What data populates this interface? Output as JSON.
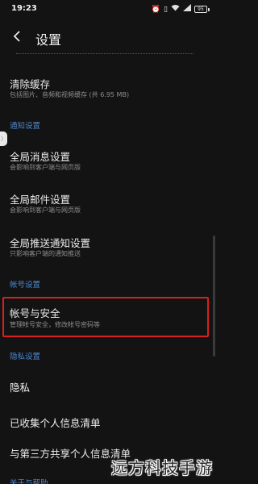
{
  "status_bar": {
    "time": "19:23",
    "icons": [
      "alarm-icon",
      "vibrate-icon",
      "wifi-icon",
      "signal-icon",
      "battery-icon"
    ],
    "battery_level": "95"
  },
  "header": {
    "title": "设置"
  },
  "items": {
    "clear_cache": {
      "title": "清除缓存",
      "subtitle": "包括图片、音频和视频缓存 (共 6.95 MB)"
    },
    "global_message": {
      "title": "全局消息设置",
      "subtitle": "会影响到客户端与网页版"
    },
    "global_mail": {
      "title": "全局邮件设置",
      "subtitle": "会影响到客户端与网页版"
    },
    "global_push": {
      "title": "全局推送通知设置",
      "subtitle": "只影响客户端的通知推送"
    },
    "account_security": {
      "title": "帐号与安全",
      "subtitle": "管理帐号安全，修改帐号密码等"
    },
    "privacy": {
      "title": "隐私"
    },
    "collected_info": {
      "title": "已收集个人信息清单"
    },
    "third_party": {
      "title": "与第三方共享个人信息清单"
    }
  },
  "sections": {
    "notification": "通知设置",
    "account": "帐号设置",
    "privacy": "隐私设置",
    "about": "关于与帮助"
  },
  "colors": {
    "background": "#131313",
    "section_accent": "#4e87cf",
    "highlight_border": "#d91f1f"
  },
  "watermark": "远方科技手游"
}
